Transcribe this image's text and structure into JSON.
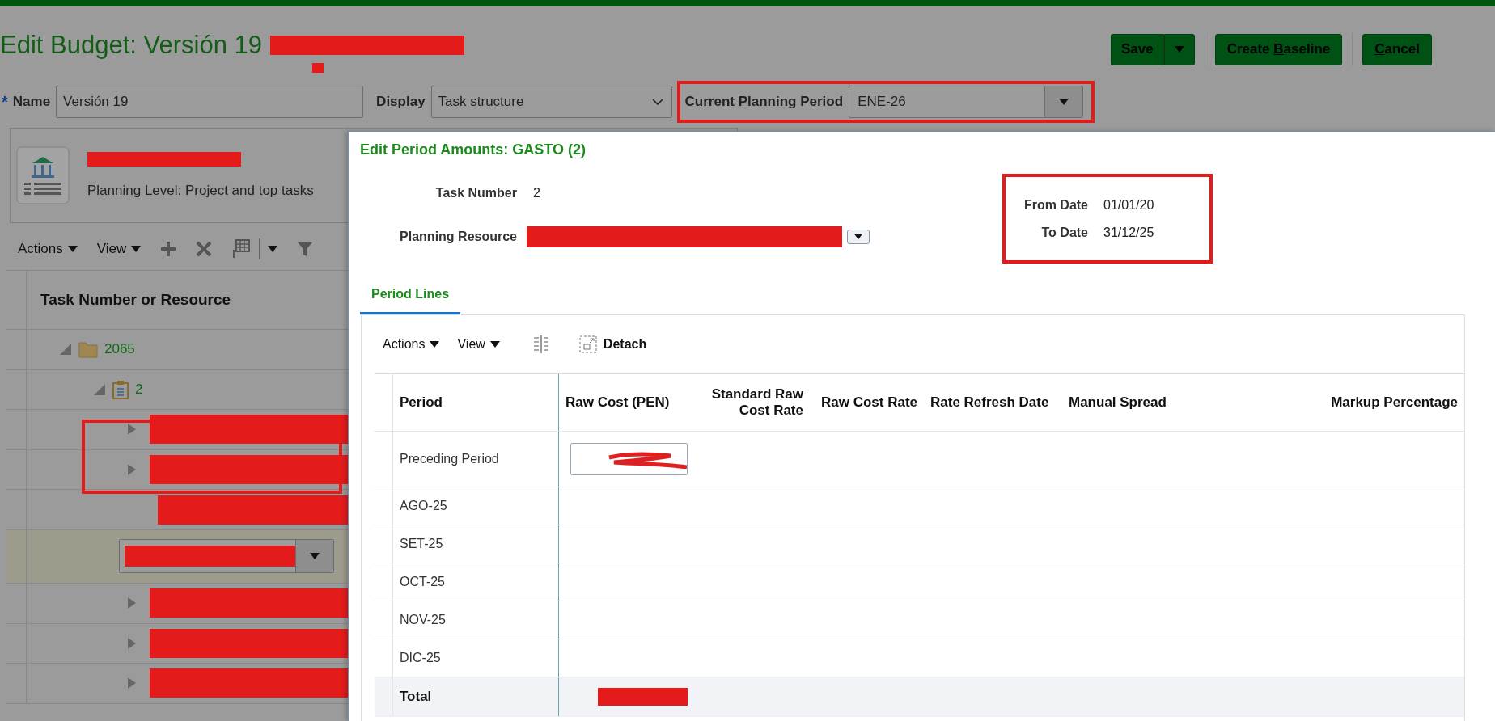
{
  "header": {
    "title": "Edit Budget: Versión 19",
    "buttons": [
      {
        "kind": "split",
        "label": "Save"
      },
      {
        "kind": "plain",
        "prefix": "Create ",
        "key": "B",
        "rest": "aseline"
      },
      {
        "kind": "plain",
        "key": "C",
        "rest": "ancel"
      }
    ]
  },
  "form": {
    "name_label": "Name",
    "required_mark": "*",
    "name_value": "Versión 19",
    "display_label": "Display",
    "display_value": "Task structure",
    "period_label": "Current Planning Period",
    "period_value": "ENE-26"
  },
  "project_card": {
    "planning_level": "Planning Level: Project and top tasks"
  },
  "toolbar": {
    "actions": "Actions",
    "view": "View"
  },
  "tree": {
    "column": "Task Number or Resource",
    "items": [
      {
        "kind": "folder",
        "label": "2065",
        "expanded": true,
        "children": [
          {
            "kind": "task",
            "label": "2",
            "expanded": true,
            "children": [
              {
                "kind": "resource",
                "expanded": false
              },
              {
                "kind": "resource",
                "expanded": false
              },
              {
                "kind": "leaf"
              },
              {
                "kind": "edit",
                "selected": true
              },
              {
                "kind": "resource",
                "expanded": false
              },
              {
                "kind": "resource",
                "expanded": false
              },
              {
                "kind": "resource",
                "expanded": false
              }
            ]
          }
        ]
      }
    ]
  },
  "dialog": {
    "title": "Edit Period Amounts: GASTO (2)",
    "task_number_label": "Task Number",
    "task_number": "2",
    "resource_label": "Planning Resource",
    "from_label": "From Date",
    "from_date": "01/01/20",
    "to_label": "To Date",
    "to_date": "31/12/25",
    "tabs": [
      {
        "label": "Period Lines",
        "selected": true
      }
    ],
    "toolbar": {
      "actions": "Actions",
      "view": "View",
      "detach": "Detach"
    },
    "columns": [
      "Period",
      "Raw Cost (PEN)",
      "Standard Raw Cost Rate",
      "Raw Cost Rate",
      "Rate Refresh Date",
      "Manual Spread",
      "Markup Percentage"
    ],
    "rows": [
      {
        "period": "Preceding Period",
        "kind": "input"
      },
      {
        "period": "AGO-25",
        "kind": "plain"
      },
      {
        "period": "SET-25",
        "kind": "plain"
      },
      {
        "period": "OCT-25",
        "kind": "plain"
      },
      {
        "period": "NOV-25",
        "kind": "plain"
      },
      {
        "period": "DIC-25",
        "kind": "plain"
      }
    ],
    "total_label": "Total"
  }
}
